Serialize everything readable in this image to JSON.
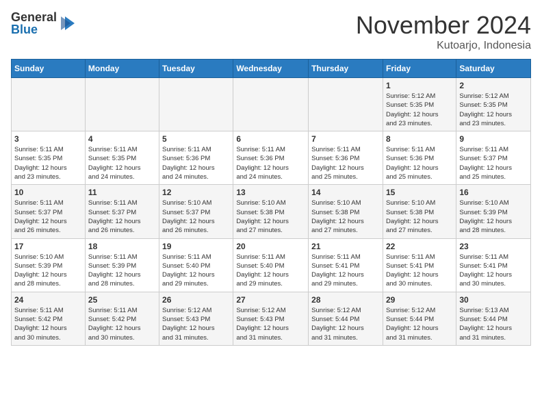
{
  "logo": {
    "general": "General",
    "blue": "Blue"
  },
  "title": "November 2024",
  "location": "Kutoarjo, Indonesia",
  "weekdays": [
    "Sunday",
    "Monday",
    "Tuesday",
    "Wednesday",
    "Thursday",
    "Friday",
    "Saturday"
  ],
  "weeks": [
    [
      {
        "day": "",
        "info": ""
      },
      {
        "day": "",
        "info": ""
      },
      {
        "day": "",
        "info": ""
      },
      {
        "day": "",
        "info": ""
      },
      {
        "day": "",
        "info": ""
      },
      {
        "day": "1",
        "info": "Sunrise: 5:12 AM\nSunset: 5:35 PM\nDaylight: 12 hours\nand 23 minutes."
      },
      {
        "day": "2",
        "info": "Sunrise: 5:12 AM\nSunset: 5:35 PM\nDaylight: 12 hours\nand 23 minutes."
      }
    ],
    [
      {
        "day": "3",
        "info": "Sunrise: 5:11 AM\nSunset: 5:35 PM\nDaylight: 12 hours\nand 23 minutes."
      },
      {
        "day": "4",
        "info": "Sunrise: 5:11 AM\nSunset: 5:35 PM\nDaylight: 12 hours\nand 24 minutes."
      },
      {
        "day": "5",
        "info": "Sunrise: 5:11 AM\nSunset: 5:36 PM\nDaylight: 12 hours\nand 24 minutes."
      },
      {
        "day": "6",
        "info": "Sunrise: 5:11 AM\nSunset: 5:36 PM\nDaylight: 12 hours\nand 24 minutes."
      },
      {
        "day": "7",
        "info": "Sunrise: 5:11 AM\nSunset: 5:36 PM\nDaylight: 12 hours\nand 25 minutes."
      },
      {
        "day": "8",
        "info": "Sunrise: 5:11 AM\nSunset: 5:36 PM\nDaylight: 12 hours\nand 25 minutes."
      },
      {
        "day": "9",
        "info": "Sunrise: 5:11 AM\nSunset: 5:37 PM\nDaylight: 12 hours\nand 25 minutes."
      }
    ],
    [
      {
        "day": "10",
        "info": "Sunrise: 5:11 AM\nSunset: 5:37 PM\nDaylight: 12 hours\nand 26 minutes."
      },
      {
        "day": "11",
        "info": "Sunrise: 5:11 AM\nSunset: 5:37 PM\nDaylight: 12 hours\nand 26 minutes."
      },
      {
        "day": "12",
        "info": "Sunrise: 5:10 AM\nSunset: 5:37 PM\nDaylight: 12 hours\nand 26 minutes."
      },
      {
        "day": "13",
        "info": "Sunrise: 5:10 AM\nSunset: 5:38 PM\nDaylight: 12 hours\nand 27 minutes."
      },
      {
        "day": "14",
        "info": "Sunrise: 5:10 AM\nSunset: 5:38 PM\nDaylight: 12 hours\nand 27 minutes."
      },
      {
        "day": "15",
        "info": "Sunrise: 5:10 AM\nSunset: 5:38 PM\nDaylight: 12 hours\nand 27 minutes."
      },
      {
        "day": "16",
        "info": "Sunrise: 5:10 AM\nSunset: 5:39 PM\nDaylight: 12 hours\nand 28 minutes."
      }
    ],
    [
      {
        "day": "17",
        "info": "Sunrise: 5:10 AM\nSunset: 5:39 PM\nDaylight: 12 hours\nand 28 minutes."
      },
      {
        "day": "18",
        "info": "Sunrise: 5:11 AM\nSunset: 5:39 PM\nDaylight: 12 hours\nand 28 minutes."
      },
      {
        "day": "19",
        "info": "Sunrise: 5:11 AM\nSunset: 5:40 PM\nDaylight: 12 hours\nand 29 minutes."
      },
      {
        "day": "20",
        "info": "Sunrise: 5:11 AM\nSunset: 5:40 PM\nDaylight: 12 hours\nand 29 minutes."
      },
      {
        "day": "21",
        "info": "Sunrise: 5:11 AM\nSunset: 5:41 PM\nDaylight: 12 hours\nand 29 minutes."
      },
      {
        "day": "22",
        "info": "Sunrise: 5:11 AM\nSunset: 5:41 PM\nDaylight: 12 hours\nand 30 minutes."
      },
      {
        "day": "23",
        "info": "Sunrise: 5:11 AM\nSunset: 5:41 PM\nDaylight: 12 hours\nand 30 minutes."
      }
    ],
    [
      {
        "day": "24",
        "info": "Sunrise: 5:11 AM\nSunset: 5:42 PM\nDaylight: 12 hours\nand 30 minutes."
      },
      {
        "day": "25",
        "info": "Sunrise: 5:11 AM\nSunset: 5:42 PM\nDaylight: 12 hours\nand 30 minutes."
      },
      {
        "day": "26",
        "info": "Sunrise: 5:12 AM\nSunset: 5:43 PM\nDaylight: 12 hours\nand 31 minutes."
      },
      {
        "day": "27",
        "info": "Sunrise: 5:12 AM\nSunset: 5:43 PM\nDaylight: 12 hours\nand 31 minutes."
      },
      {
        "day": "28",
        "info": "Sunrise: 5:12 AM\nSunset: 5:44 PM\nDaylight: 12 hours\nand 31 minutes."
      },
      {
        "day": "29",
        "info": "Sunrise: 5:12 AM\nSunset: 5:44 PM\nDaylight: 12 hours\nand 31 minutes."
      },
      {
        "day": "30",
        "info": "Sunrise: 5:13 AM\nSunset: 5:44 PM\nDaylight: 12 hours\nand 31 minutes."
      }
    ]
  ]
}
